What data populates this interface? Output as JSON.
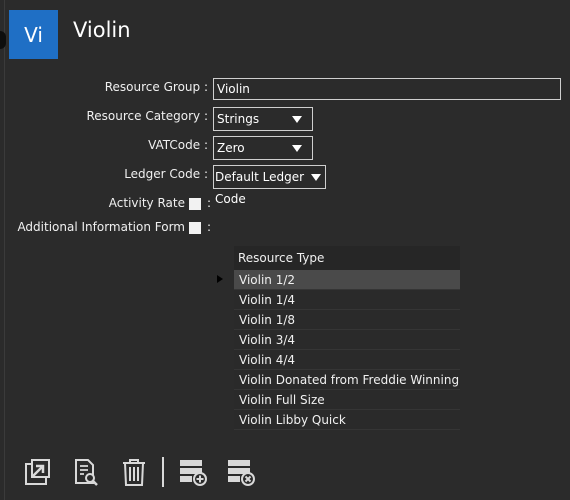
{
  "header": {
    "avatar_text": "Vi",
    "title": "Violin"
  },
  "form": {
    "resource_group": {
      "label": "Resource Group :",
      "value": "Violin"
    },
    "resource_category": {
      "label": "Resource Category :",
      "value": "Strings"
    },
    "vat_code": {
      "label": "VATCode :",
      "value": "Zero"
    },
    "ledger_code": {
      "label": "Ledger Code :",
      "value": "Default Ledger Code"
    },
    "activity_rate": {
      "label": "Activity Rate",
      "colon": ":",
      "checked": false
    },
    "additional_info_form": {
      "label": "Additional Information Form",
      "colon": ":",
      "checked": false
    }
  },
  "grid": {
    "header": "Resource Type",
    "rows": [
      "Violin 1/2",
      "Violin 1/4",
      "Violin 1/8",
      "Violin 3/4",
      "Violin 4/4",
      "Violin Donated from Freddie Winning",
      "Violin Full Size",
      "Violin Libby Quick"
    ],
    "selected_index": 0
  },
  "toolbar": {
    "icons": [
      "open-external-icon",
      "search-document-icon",
      "delete-trash-icon",
      "add-record-icon",
      "remove-record-icon"
    ]
  }
}
